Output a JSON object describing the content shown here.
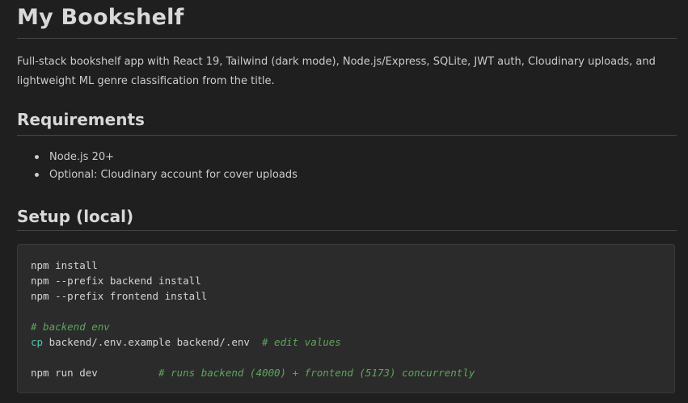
{
  "page": {
    "title": "My Bookshelf",
    "intro": "Full-stack bookshelf app with React 19, Tailwind (dark mode), Node.js/Express, SQLite, JWT auth, Cloudinary uploads, and lightweight ML genre classification from the title."
  },
  "requirements": {
    "heading": "Requirements",
    "items": [
      "Node.js 20+",
      "Optional: Cloudinary account for cover uploads"
    ]
  },
  "setup": {
    "heading": "Setup (local)",
    "code": {
      "line1": "npm install",
      "line2": "npm --prefix backend install",
      "line3": "npm --prefix frontend install",
      "line5_comment": "# backend env",
      "line6_cmd": "cp",
      "line6_args": " backend/.env.example backend/.env  ",
      "line6_comment": "# edit values",
      "line8_cmd": "npm run dev          ",
      "line8_comment": "# runs backend (4000) + frontend (5173) concurrently"
    }
  },
  "colors": {
    "background": "#1f1f1f",
    "code_background": "#2b2b2b",
    "comment": "#5ea55e",
    "command_keyword": "#4ec9b0"
  }
}
